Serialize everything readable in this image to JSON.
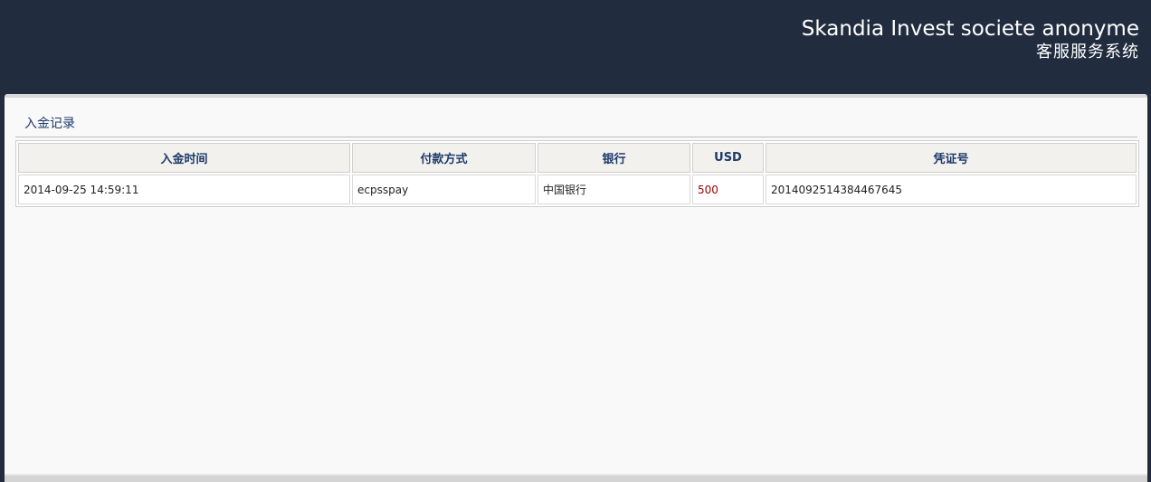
{
  "header": {
    "company_name": "Skandia Invest societe anonyme",
    "system_name": "客服服务系统"
  },
  "section": {
    "title": "入金记录"
  },
  "table": {
    "columns": [
      "入金时间",
      "付款方式",
      "银行",
      "USD",
      "凭证号"
    ],
    "rows": [
      {
        "time": "2014-09-25 14:59:11",
        "payment_method": "ecpsspay",
        "bank": "中国银行",
        "usd": "500",
        "voucher_no": "2014092514384467645"
      }
    ]
  },
  "colors": {
    "header_bg": "#212d3f",
    "panel_bg": "#f9f9f9",
    "heading_text": "#1d3a6a",
    "amount_text": "#a10000"
  }
}
